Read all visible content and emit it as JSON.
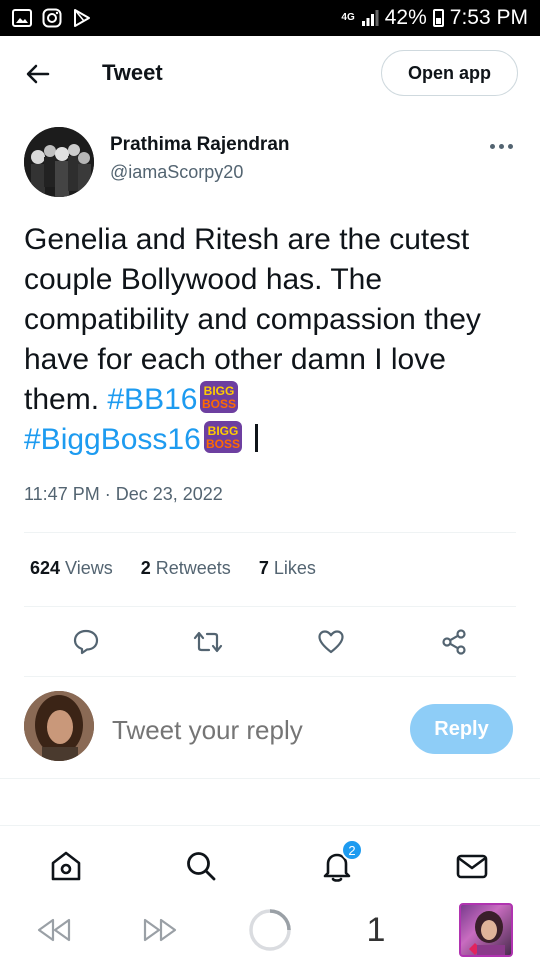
{
  "status_bar": {
    "network": "4G",
    "battery": "42%",
    "time": "7:53 PM"
  },
  "header": {
    "title": "Tweet",
    "open_app_label": "Open app"
  },
  "author": {
    "name": "Prathima Rajendran",
    "handle": "@iamaScorpy20"
  },
  "tweet": {
    "text_main": "Genelia and Ritesh are the cutest couple Bollywood has. The compatibility and compassion they have for each other damn I love them. ",
    "hashtag1": "#BB16",
    "hashtag2": "#BiggBoss16",
    "emoji_label": "BIGG BOSS",
    "emoji_line1": "BIGG",
    "emoji_line2": "BOSS",
    "timestamp": "11:47 PM · Dec 23, 2022"
  },
  "stats": {
    "views_count": "624",
    "views_label": "Views",
    "retweets_count": "2",
    "retweets_label": "Retweets",
    "likes_count": "7",
    "likes_label": "Likes"
  },
  "reply": {
    "placeholder": "Tweet your reply",
    "button_label": "Reply"
  },
  "bottom_nav": {
    "notifications_badge": "2"
  },
  "browser_bar": {
    "tab_count": "1"
  },
  "colors": {
    "accent": "#1d9bf0",
    "reply_button_disabled": "#8ecdf7",
    "secondary_text": "#536471"
  }
}
